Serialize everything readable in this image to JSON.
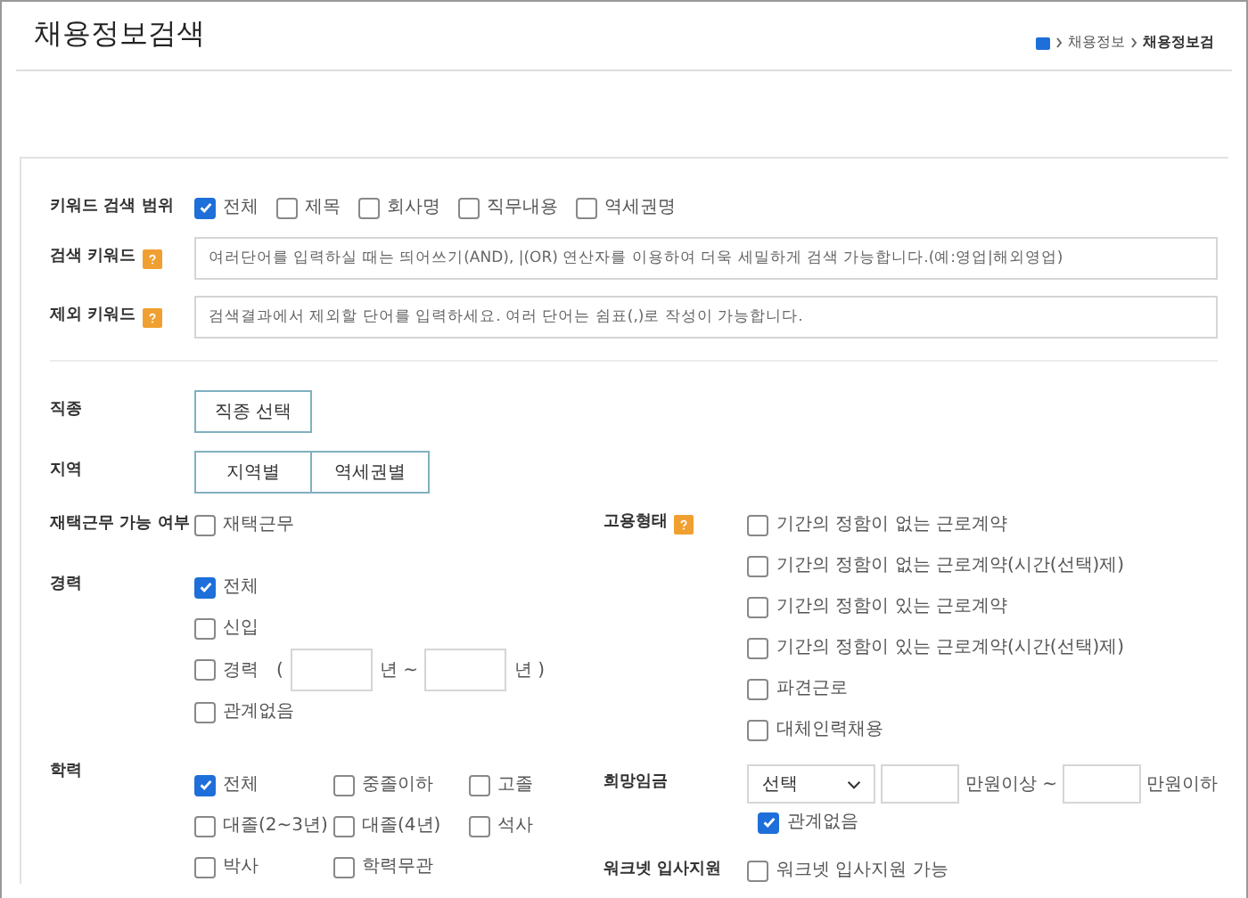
{
  "title": "채용정보검색",
  "breadcrumb": [
    "채용정보",
    "채용정보검"
  ],
  "keyword_scope": {
    "label": "키워드 검색 범위",
    "options": [
      {
        "label": "전체",
        "checked": true
      },
      {
        "label": "제목",
        "checked": false
      },
      {
        "label": "회사명",
        "checked": false
      },
      {
        "label": "직무내용",
        "checked": false
      },
      {
        "label": "역세권명",
        "checked": false
      }
    ]
  },
  "search_keyword": {
    "label": "검색 키워드",
    "placeholder": "여러단어를 입력하실 때는 띄어쓰기(AND), |(OR) 연산자를 이용하여 더욱 세밀하게 검색 가능합니다.(예:영업|해외영업)"
  },
  "exclude_keyword": {
    "label": "제외 키워드",
    "placeholder": "검색결과에서 제외할 단어를 입력하세요. 여러 단어는 쉼표(,)로 작성이 가능합니다."
  },
  "job_type": {
    "label": "직종",
    "button": "직종 선택"
  },
  "region": {
    "label": "지역",
    "buttons": [
      "지역별",
      "역세권별"
    ]
  },
  "remote": {
    "label": "재택근무 가능 여부",
    "option": {
      "label": "재택근무",
      "checked": false
    }
  },
  "career": {
    "label": "경력",
    "options": [
      {
        "kind": "checkbox",
        "label": "전체",
        "checked": true
      },
      {
        "kind": "checkbox",
        "label": "신입",
        "checked": false
      },
      {
        "kind": "range",
        "label": "경력",
        "open": "(",
        "unit1": "년 ~",
        "unit2": "년 )",
        "checked": false
      },
      {
        "kind": "checkbox",
        "label": "관계없음",
        "checked": false
      }
    ]
  },
  "education": {
    "label": "학력",
    "options": [
      {
        "label": "전체",
        "checked": true
      },
      {
        "label": "중졸이하",
        "checked": false
      },
      {
        "label": "고졸",
        "checked": false
      },
      {
        "label": "대졸(2~3년)",
        "checked": false
      },
      {
        "label": "대졸(4년)",
        "checked": false
      },
      {
        "label": "석사",
        "checked": false
      },
      {
        "label": "박사",
        "checked": false
      },
      {
        "label": "학력무관",
        "checked": false
      }
    ]
  },
  "employment": {
    "label": "고용형태",
    "options": [
      {
        "label": "기간의 정함이 없는 근로계약",
        "checked": false
      },
      {
        "label": "기간의 정함이 없는 근로계약(시간(선택)제)",
        "checked": false
      },
      {
        "label": "기간의 정함이 있는 근로계약",
        "checked": false
      },
      {
        "label": "기간의 정함이 있는 근로계약(시간(선택)제)",
        "checked": false
      },
      {
        "label": "파견근로",
        "checked": false
      },
      {
        "label": "대체인력채용",
        "checked": false
      }
    ]
  },
  "wage": {
    "label": "희망임금",
    "select": "선택",
    "unit1": "만원이상 ~",
    "unit2": "만원이하",
    "option": {
      "label": "관계없음",
      "checked": true
    }
  },
  "worknet": {
    "label": "워크넷 입사지원",
    "option": {
      "label": "워크넷 입사지원 가능",
      "checked": false
    }
  }
}
